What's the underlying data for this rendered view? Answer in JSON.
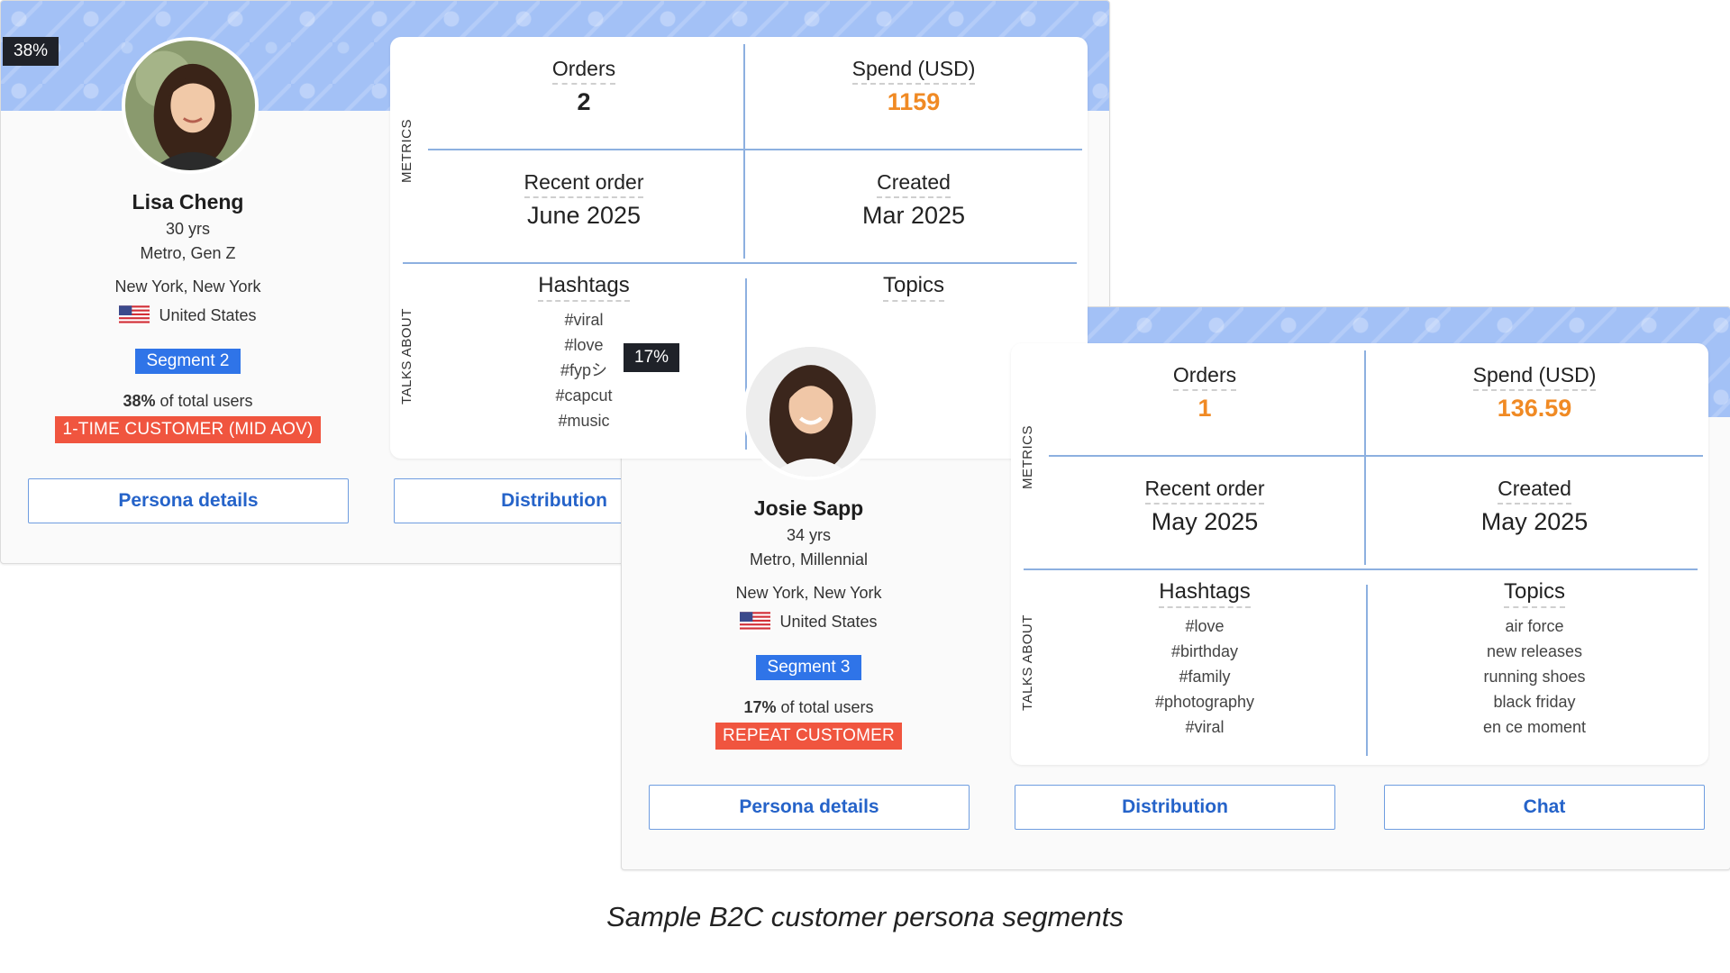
{
  "caption": "Sample B2C customer persona segments",
  "colors": {
    "accent_blue": "#2f74e8",
    "orange_value": "#f08a24",
    "customer_type_red": "#f0553f",
    "banner_blue": "#a3c1f6",
    "button_text": "#2563c9"
  },
  "personas": [
    {
      "percent_badge": "38%",
      "name": "Lisa Cheng",
      "age": "30 yrs",
      "demographic": "Metro, Gen Z",
      "location": "New York, New York",
      "country": "United States",
      "flag_icon": "us-flag-icon",
      "segment": "Segment 2",
      "share_pct": "38%",
      "share_suffix": " of total users",
      "customer_type": "1-TIME CUSTOMER (MID AOV)",
      "metrics_label": "METRICS",
      "talks_label": "TALKS ABOUT",
      "orders_label": "Orders",
      "orders_value": "2",
      "spend_label": "Spend (USD)",
      "spend_value": "1159",
      "recent_label": "Recent order",
      "recent_value": "June 2025",
      "created_label": "Created",
      "created_value": "Mar 2025",
      "hashtags_label": "Hashtags",
      "hashtags": [
        "#viral",
        "#love",
        "#fypシ",
        "#capcut",
        "#music"
      ],
      "topics_label": "Topics",
      "topics": [],
      "buttons": {
        "details": "Persona details",
        "distribution": "Distribution"
      }
    },
    {
      "percent_badge": "17%",
      "name": "Josie Sapp",
      "age": "34 yrs",
      "demographic": "Metro, Millennial",
      "location": "New York, New York",
      "country": "United States",
      "flag_icon": "us-flag-icon",
      "segment": "Segment 3",
      "share_pct": "17%",
      "share_suffix": " of total users",
      "customer_type": "REPEAT CUSTOMER",
      "metrics_label": "METRICS",
      "talks_label": "TALKS ABOUT",
      "orders_label": "Orders",
      "orders_value": "1",
      "spend_label": "Spend (USD)",
      "spend_value": "136.59",
      "recent_label": "Recent order",
      "recent_value": "May 2025",
      "created_label": "Created",
      "created_value": "May 2025",
      "hashtags_label": "Hashtags",
      "hashtags": [
        "#love",
        "#birthday",
        "#family",
        "#photography",
        "#viral"
      ],
      "topics_label": "Topics",
      "topics": [
        "air force",
        "new releases",
        "running shoes",
        "black friday",
        "en ce moment"
      ],
      "buttons": {
        "details": "Persona details",
        "distribution": "Distribution",
        "chat": "Chat"
      }
    }
  ]
}
